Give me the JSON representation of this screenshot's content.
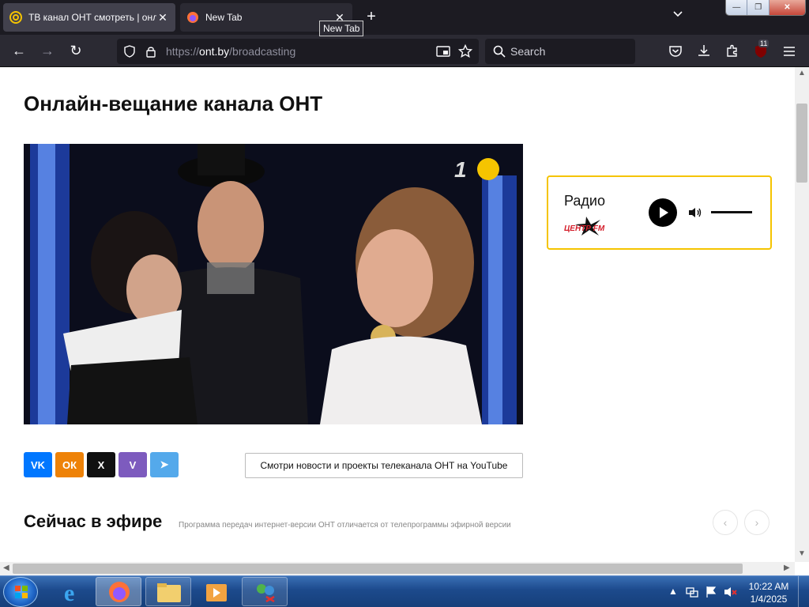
{
  "browser": {
    "tabs": [
      {
        "title": "ТВ канал ОНТ смотреть | онла",
        "active": true
      },
      {
        "title": "New Tab",
        "active": false
      }
    ],
    "tooltip": "New Tab",
    "url": {
      "scheme": "https://",
      "host": "ont.by",
      "path": "/broadcasting"
    },
    "search_placeholder": "Search",
    "extensions_badge": "11",
    "colors": {
      "tabbar": "#1c1b22",
      "navbar": "#2b2a33",
      "urlbar": "#1c1b22"
    }
  },
  "page": {
    "title": "Онлайн-вещание канала ОНТ",
    "radio": {
      "label": "Радио",
      "logo_text": "ЦЕНТР FM",
      "accent": "#f5c400"
    },
    "share_buttons": [
      {
        "name": "vk",
        "label": "VK",
        "color": "#0077ff"
      },
      {
        "name": "odnoklassniki",
        "label": "ОК",
        "color": "#ee8208"
      },
      {
        "name": "x",
        "label": "X",
        "color": "#111111"
      },
      {
        "name": "viber",
        "label": "V",
        "color": "#7d5bbe"
      },
      {
        "name": "telegram",
        "label": "➤",
        "color": "#54a9eb"
      }
    ],
    "youtube_button": "Смотри новости и проекты телеканала ОНТ на YouTube",
    "on_air": {
      "title": "Сейчас в эфире",
      "note": "Программа передач интернет-версии ОНТ отличается от телепрограммы эфирной версии"
    }
  },
  "taskbar": {
    "clock_time": "10:22 AM",
    "clock_date": "1/4/2025"
  }
}
